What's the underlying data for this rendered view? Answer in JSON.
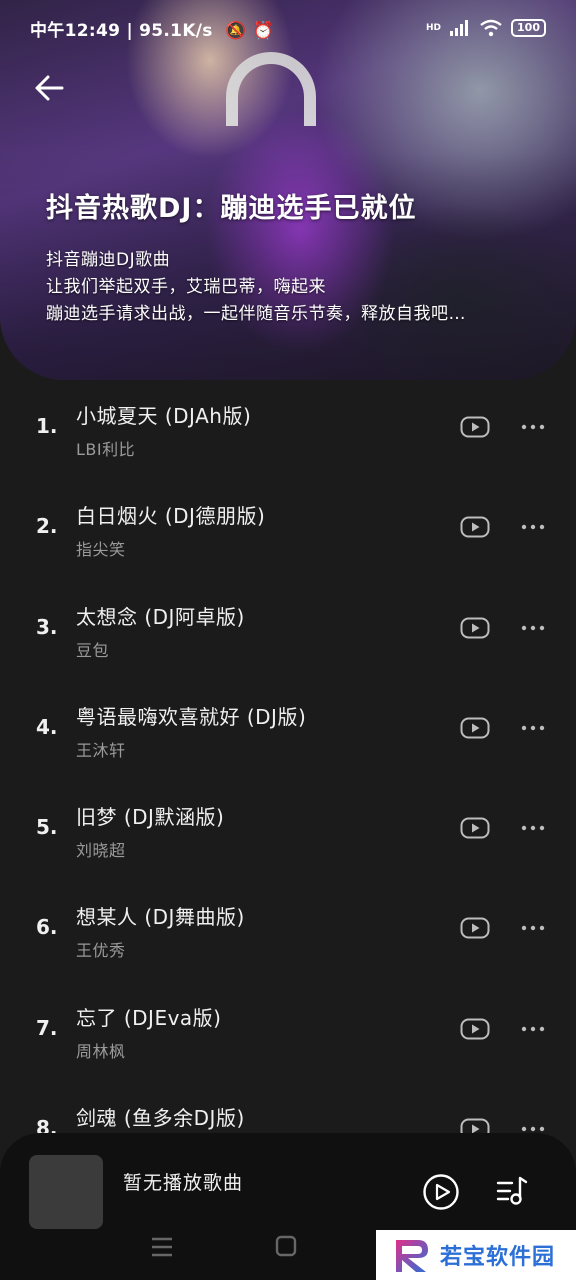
{
  "status_bar": {
    "time": "中午12:49",
    "speed": "95.1K/s",
    "battery": "100",
    "hd_label": "HD"
  },
  "header": {
    "title": "抖音热歌DJ：蹦迪选手已就位",
    "description": [
      "抖音蹦迪DJ歌曲",
      "让我们举起双手，艾瑞巴蒂，嗨起来",
      "蹦迪选手请求出战，一起伴随音乐节奏，释放自我吧…"
    ]
  },
  "songs": [
    {
      "num": "1.",
      "title": "小城夏天 (DJAh版)",
      "artist": "LBI利比"
    },
    {
      "num": "2.",
      "title": "白日烟火 (DJ德朋版)",
      "artist": "指尖笑"
    },
    {
      "num": "3.",
      "title": "太想念 (DJ阿卓版)",
      "artist": "豆包"
    },
    {
      "num": "4.",
      "title": "粤语最嗨欢喜就好 (DJ版)",
      "artist": "王沐轩"
    },
    {
      "num": "5.",
      "title": "旧梦 (DJ默涵版)",
      "artist": "刘晓超"
    },
    {
      "num": "6.",
      "title": "想某人 (DJ舞曲版)",
      "artist": "王优秀"
    },
    {
      "num": "7.",
      "title": "忘了 (DJEva版)",
      "artist": "周林枫"
    },
    {
      "num": "8.",
      "title": "剑魂 (鱼多余DJ版)",
      "artist": ""
    }
  ],
  "player": {
    "now_playing": "暂无播放歌曲"
  },
  "watermark": {
    "text": "若宝软件园"
  },
  "colors": {
    "background": "#1b1b1b",
    "player_bg": "#101010",
    "secondary_text": "#9a9a9a",
    "watermark_blue": "#2c6fd6"
  }
}
